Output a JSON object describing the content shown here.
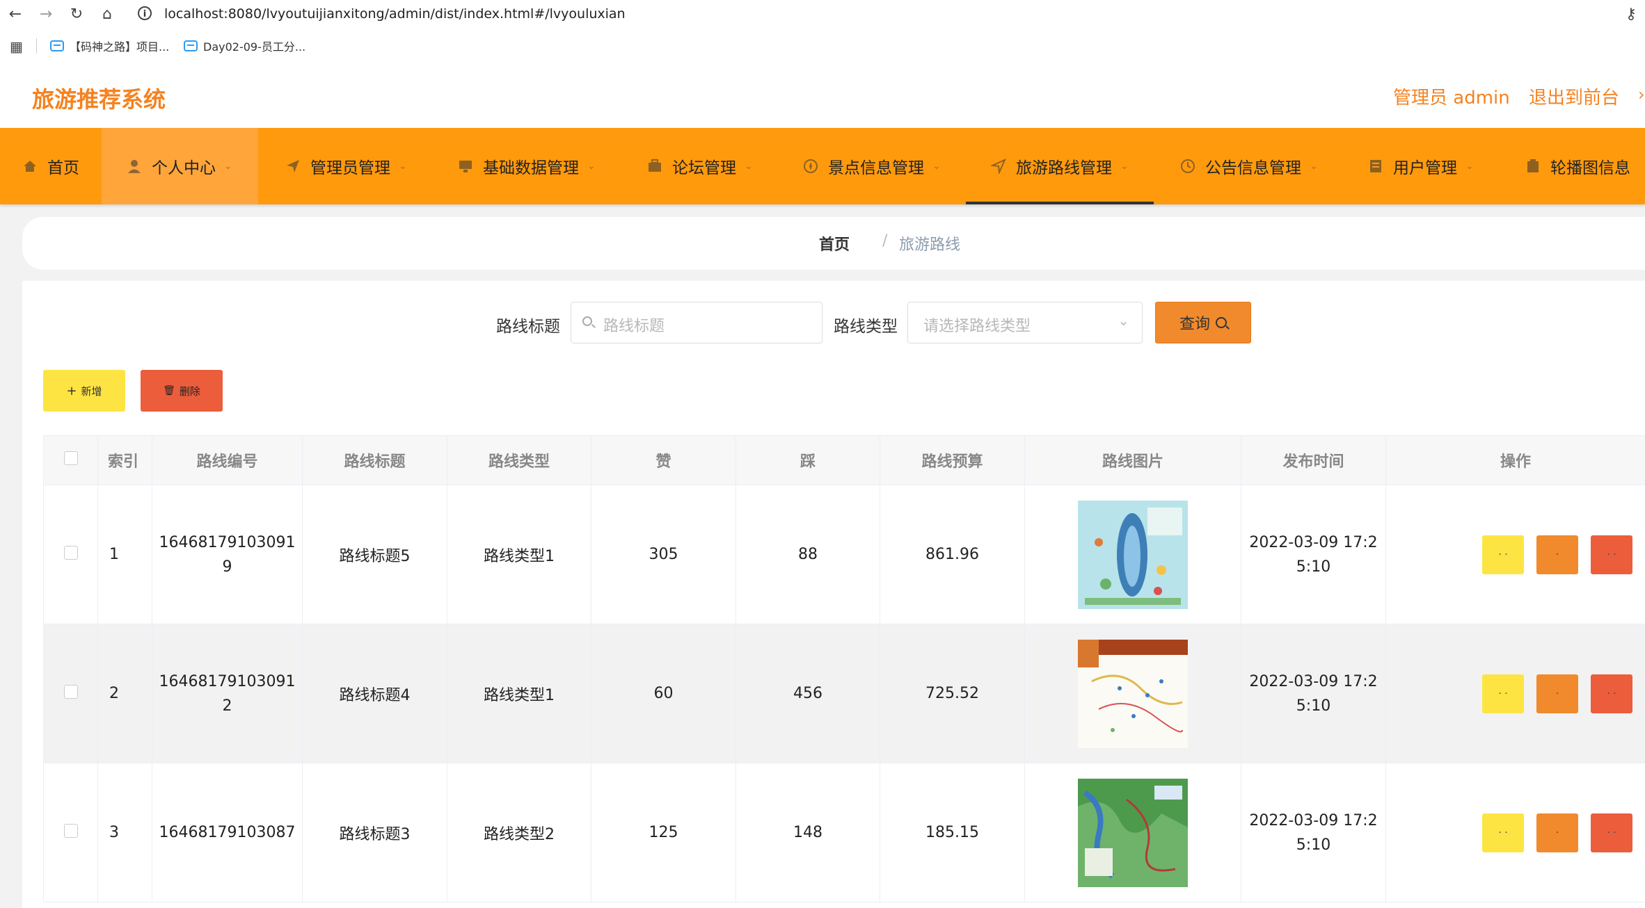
{
  "browser": {
    "url": "localhost:8080/lvyoutuijianxitong/admin/dist/index.html#/lvyouluxian",
    "bookmarks": [
      "【码神之路】项目...",
      "Day02-09-员工分..."
    ]
  },
  "header": {
    "app_title": "旅游推荐系统",
    "user_label": "管理员 admin",
    "exit_label": "退出到前台",
    "more": "›"
  },
  "nav": {
    "items": [
      {
        "label": "首页",
        "icon": "home-icon"
      },
      {
        "label": "个人中心",
        "icon": "user-icon"
      },
      {
        "label": "管理员管理",
        "icon": "send-icon"
      },
      {
        "label": "基础数据管理",
        "icon": "monitor-icon"
      },
      {
        "label": "论坛管理",
        "icon": "briefcase-icon"
      },
      {
        "label": "景点信息管理",
        "icon": "compass-icon"
      },
      {
        "label": "旅游路线管理",
        "icon": "navigation-icon"
      },
      {
        "label": "公告信息管理",
        "icon": "clock-icon"
      },
      {
        "label": "用户管理",
        "icon": "document-icon"
      },
      {
        "label": "轮播图信息",
        "icon": "clipboard-icon"
      }
    ]
  },
  "breadcrumb": {
    "home": "首页",
    "separator": "/",
    "current": "旅游路线"
  },
  "search": {
    "title_label": "路线标题",
    "title_placeholder": "路线标题",
    "type_label": "路线类型",
    "type_placeholder": "请选择路线类型",
    "query_label": "查询"
  },
  "actions": {
    "add_label": "新增",
    "delete_label": "删除"
  },
  "table": {
    "headers": [
      "索引",
      "路线编号",
      "路线标题",
      "路线类型",
      "赞",
      "踩",
      "路线预算",
      "路线图片",
      "发布时间",
      "操作"
    ],
    "rows": [
      {
        "index": "1",
        "code_a": "16468179103091",
        "code_b": "9",
        "title": "路线标题5",
        "type": "路线类型1",
        "likes": "305",
        "dislikes": "88",
        "budget": "861.96",
        "time_a": "2022-03-09 17:2",
        "time_b": "5:10"
      },
      {
        "index": "2",
        "code_a": "16468179103091",
        "code_b": "2",
        "title": "路线标题4",
        "type": "路线类型1",
        "likes": "60",
        "dislikes": "456",
        "budget": "725.52",
        "time_a": "2022-03-09 17:2",
        "time_b": "5:10"
      },
      {
        "index": "3",
        "code_a": "16468179103087",
        "code_b": "",
        "title": "路线标题3",
        "type": "路线类型2",
        "likes": "125",
        "dislikes": "148",
        "budget": "185.15",
        "time_a": "2022-03-09 17:2",
        "time_b": "5:10"
      }
    ]
  },
  "colors": {
    "brand": "#f5821f",
    "nav_bg": "#ff9a0d",
    "query_btn": "#f08a2c",
    "add_btn": "#fde442",
    "delete_btn": "#ec5d3c"
  }
}
